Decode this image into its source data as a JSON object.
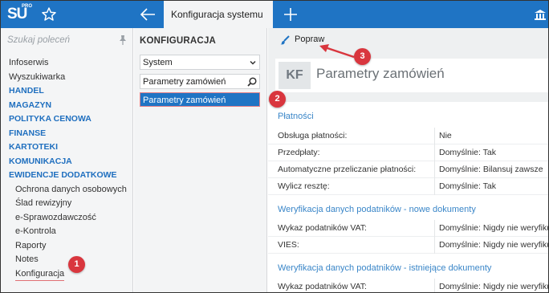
{
  "app": {
    "logo_text": "SU",
    "logo_sup": "PRO",
    "active_tab": "Konfiguracja systemu"
  },
  "sidebar": {
    "search_placeholder": "Szukaj poleceń",
    "items": [
      {
        "label": "Infoserwis",
        "type": "item"
      },
      {
        "label": "Wyszukiwarka",
        "type": "item"
      },
      {
        "label": "HANDEL",
        "type": "section"
      },
      {
        "label": "MAGAZYN",
        "type": "section"
      },
      {
        "label": "POLITYKA CENOWA",
        "type": "section"
      },
      {
        "label": "FINANSE",
        "type": "section"
      },
      {
        "label": "KARTOTEKI",
        "type": "section"
      },
      {
        "label": "KOMUNIKACJA",
        "type": "section"
      },
      {
        "label": "EWIDENCJE DODATKOWE",
        "type": "section"
      },
      {
        "label": "Ochrona danych osobowych",
        "type": "sub"
      },
      {
        "label": "Ślad rewizyjny",
        "type": "sub"
      },
      {
        "label": "e-Sprawozdawczość",
        "type": "sub"
      },
      {
        "label": "e-Kontrola",
        "type": "sub"
      },
      {
        "label": "Raporty",
        "type": "sub"
      },
      {
        "label": "Notes",
        "type": "sub"
      },
      {
        "label": "Konfiguracja",
        "type": "sub"
      }
    ]
  },
  "config_panel": {
    "title": "KONFIGURACJA",
    "dropdown_value": "System",
    "filter_value": "Parametry zamówień",
    "selected_item": "Parametry zamówień"
  },
  "toolbar": {
    "edit_label": "Popraw"
  },
  "header": {
    "badge": "KF",
    "title": "Parametry zamówień"
  },
  "sections": [
    {
      "title": "Płatności",
      "rows": [
        {
          "label": "Obsługa płatności:",
          "value": "Nie"
        },
        {
          "label": "Przedpłaty:",
          "value": "Domyślnie: Tak"
        },
        {
          "label": "Automatyczne przeliczanie płatności:",
          "value": "Domyślnie: Bilansuj zawsze"
        },
        {
          "label": "Wylicz resztę:",
          "value": "Domyślnie: Tak"
        }
      ]
    },
    {
      "title": "Weryfikacja danych podatników - nowe dokumenty",
      "rows": [
        {
          "label": "Wykaz podatników VAT:",
          "value": "Domyślnie: Nigdy nie weryfikuj"
        },
        {
          "label": "VIES:",
          "value": "Domyślnie: Nigdy nie weryfikuj"
        }
      ]
    },
    {
      "title": "Weryfikacja danych podatników - istniejące dokumenty",
      "rows": [
        {
          "label": "Wykaz podatników VAT:",
          "value": "Domyślnie: Nigdy nie weryfikuj"
        }
      ]
    }
  ],
  "callouts": [
    "1",
    "2",
    "3"
  ],
  "colors": {
    "topbar": "#1f74c4",
    "section_blue": "#1f6fbf",
    "callout_red": "#d9363e"
  }
}
